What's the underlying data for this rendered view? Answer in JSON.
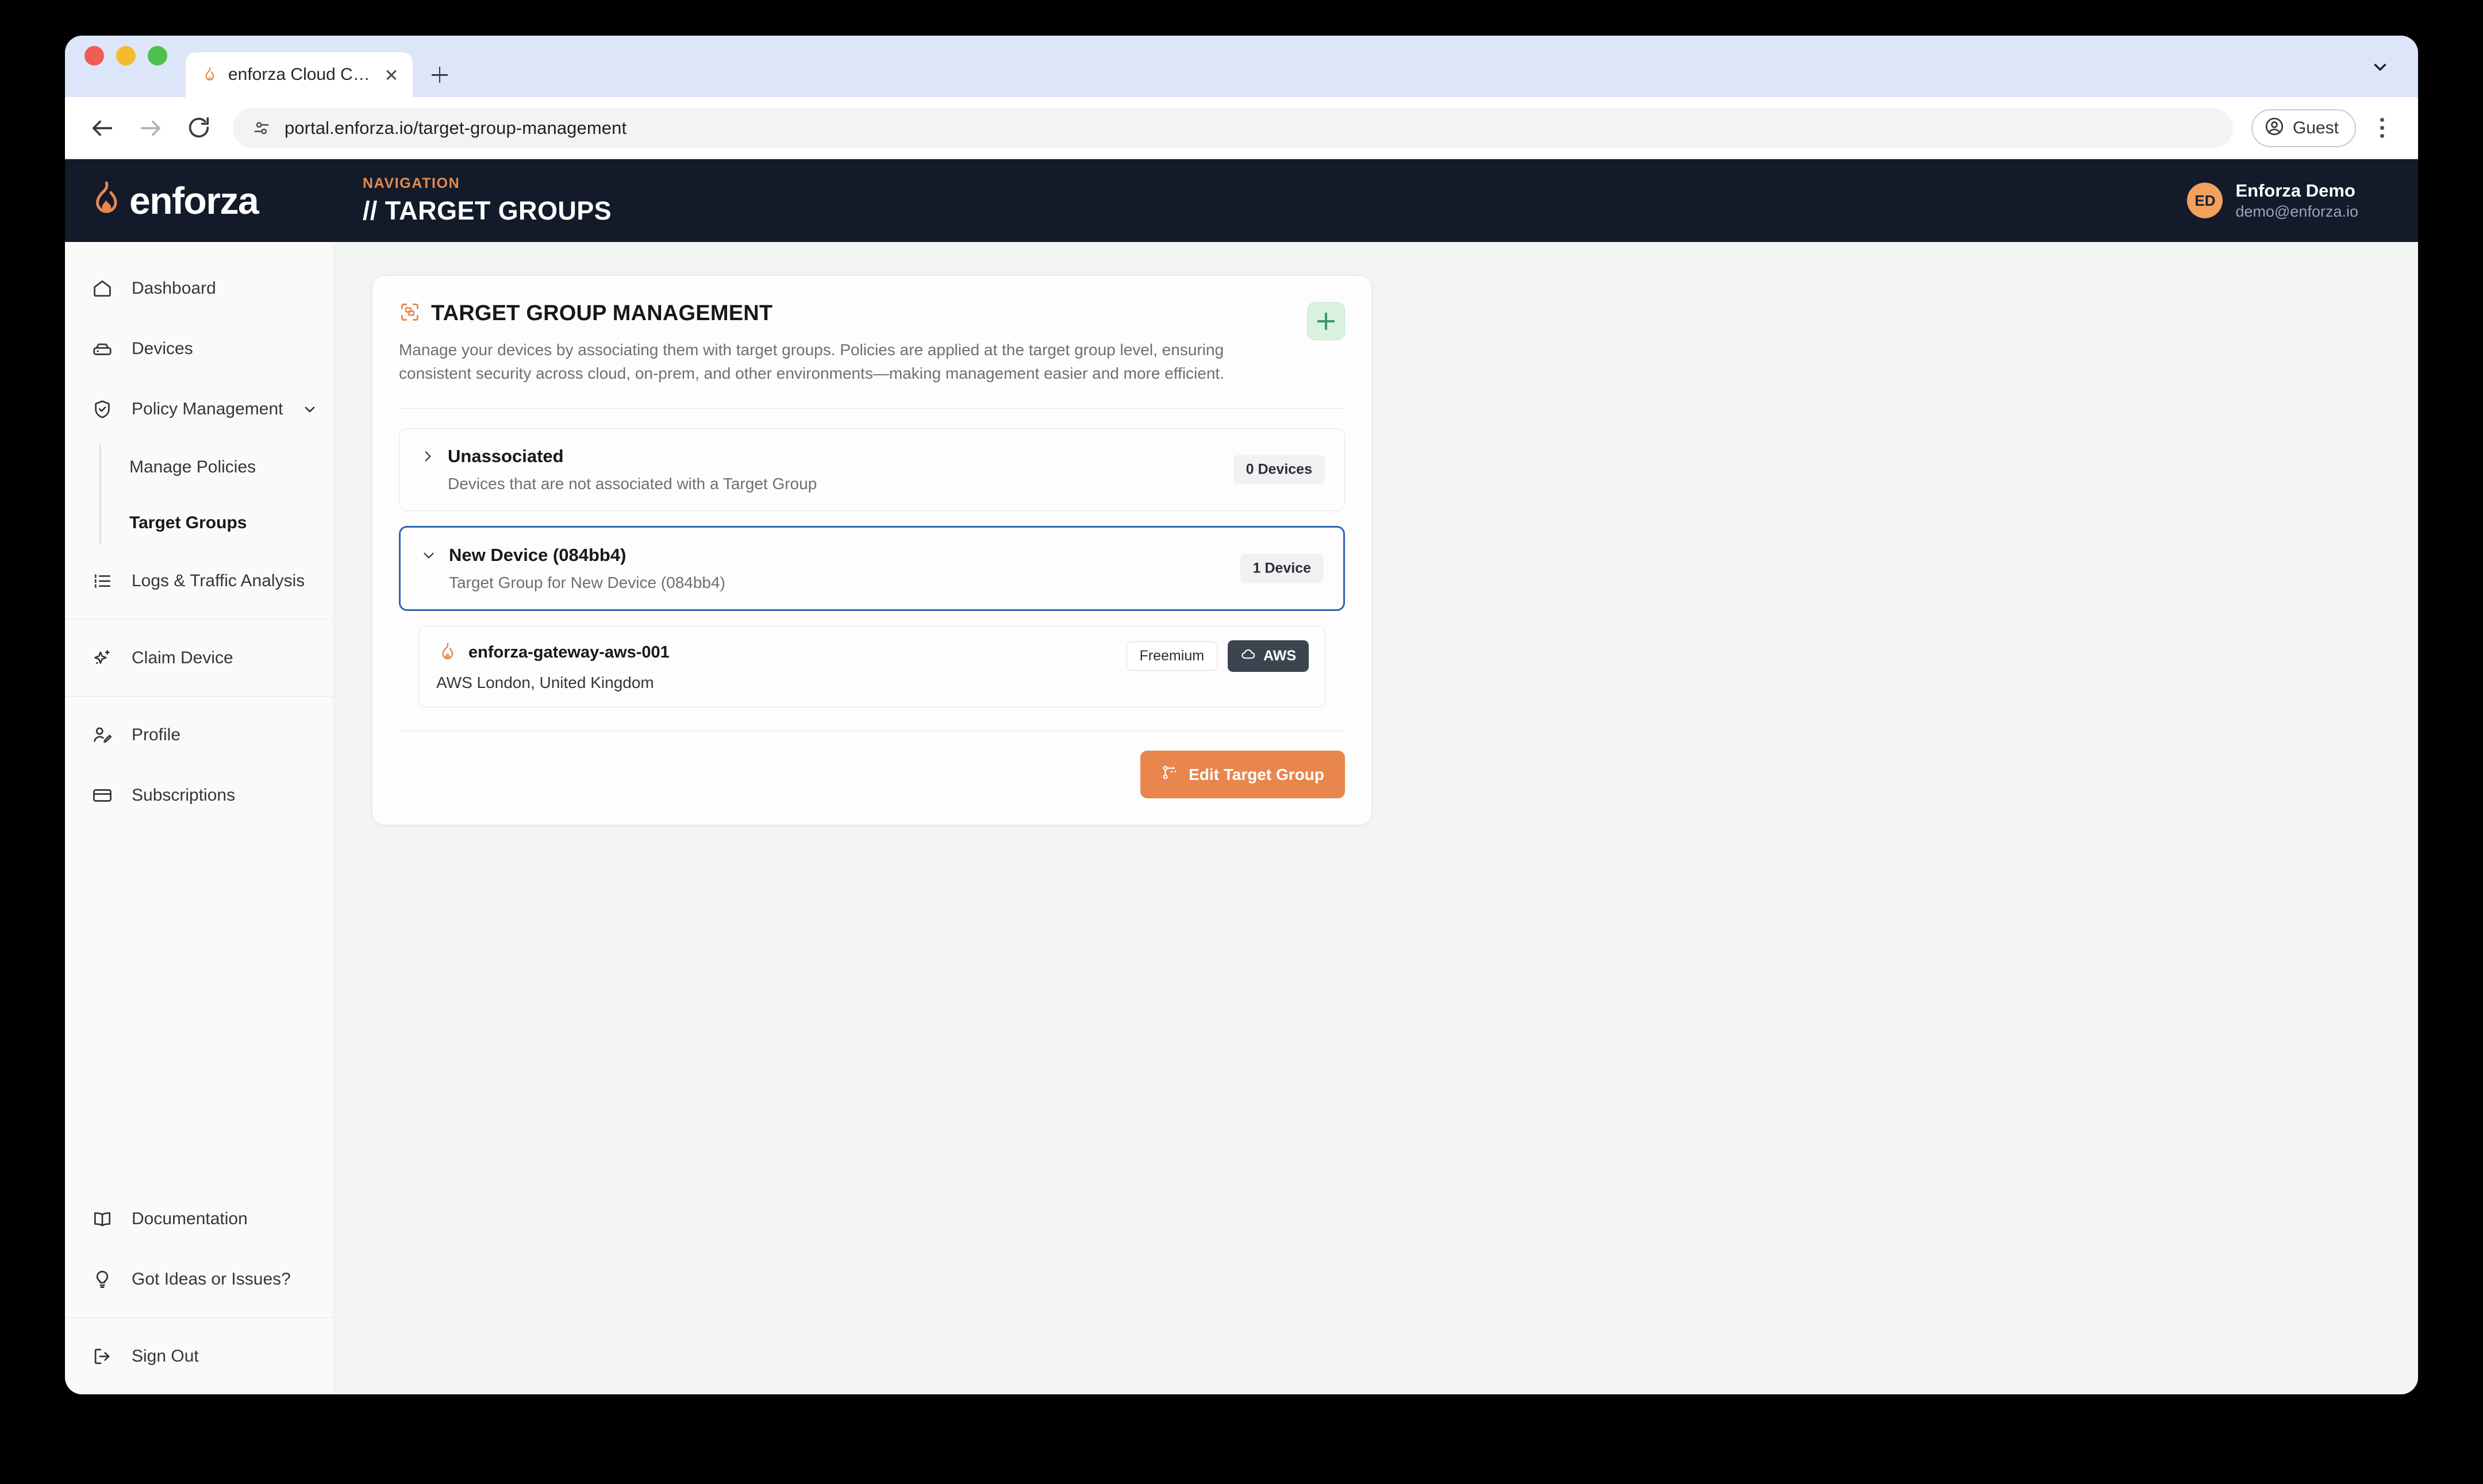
{
  "browser": {
    "tab": {
      "title": "enforza Cloud Controller",
      "favicon_icon": "flame-icon",
      "close_icon": "close-icon"
    },
    "new_tab_icon": "plus-icon",
    "tab_search_icon": "chevron-down-icon",
    "back_icon": "arrow-left-icon",
    "forward_icon": "arrow-right-icon",
    "reload_icon": "reload-icon",
    "site_info_icon": "tune-icon",
    "url": "portal.enforza.io/target-group-management",
    "profile": {
      "label": "Guest",
      "icon": "account-circle-icon"
    },
    "menu_icon": "kebab-menu-icon"
  },
  "header": {
    "logo_text": "enforza",
    "logo_icon": "flame-icon",
    "kicker": "NAVIGATION",
    "title": "// TARGET GROUPS",
    "user": {
      "initials": "ED",
      "name": "Enforza Demo",
      "email": "demo@enforza.io"
    }
  },
  "sidebar": {
    "items": [
      {
        "label": "Dashboard",
        "icon": "home-icon",
        "active": false
      },
      {
        "label": "Devices",
        "icon": "server-icon",
        "active": false
      },
      {
        "label": "Policy Management",
        "icon": "shield-check-icon",
        "expanded": true,
        "chevron": "chevron-down-icon"
      },
      {
        "label": "Logs & Traffic Analysis",
        "icon": "list-icon",
        "active": false
      },
      {
        "label": "Claim Device",
        "icon": "sparkle-icon",
        "active": false
      },
      {
        "label": "Profile",
        "icon": "user-edit-icon",
        "active": false
      },
      {
        "label": "Subscriptions",
        "icon": "credit-card-icon",
        "active": false
      }
    ],
    "submenu": [
      {
        "label": "Manage Policies",
        "active": false
      },
      {
        "label": "Target Groups",
        "active": true
      }
    ],
    "bottom": [
      {
        "label": "Documentation",
        "icon": "book-icon"
      },
      {
        "label": "Got Ideas or Issues?",
        "icon": "lightbulb-icon"
      },
      {
        "label": "Sign Out",
        "icon": "logout-icon"
      }
    ]
  },
  "card": {
    "icon": "scan-target-icon",
    "title": "TARGET GROUP MANAGEMENT",
    "description": "Manage your devices by associating them with target groups. Policies are applied at the target group level, ensuring consistent security across cloud, on-prem, and other environments—making management easier and more efficient.",
    "add_button_icon": "plus-icon",
    "groups": [
      {
        "name": "Unassociated",
        "subtitle": "Devices that are not associated with a Target Group",
        "badge": "0 Devices",
        "expanded": false,
        "chevron": "chevron-right-icon",
        "selected": false
      },
      {
        "name": "New Device (084bb4)",
        "subtitle": "Target Group for New Device (084bb4)",
        "badge": "1 Device",
        "expanded": true,
        "chevron": "chevron-down-icon",
        "selected": true
      }
    ],
    "device": {
      "icon": "flame-icon",
      "name": "enforza-gateway-aws-001",
      "location": "AWS London, United Kingdom",
      "tier_badge": "Freemium",
      "cloud_badge": "AWS",
      "cloud_icon": "cloud-icon"
    },
    "edit_button": {
      "label": "Edit Target Group",
      "icon": "network-nodes-icon"
    }
  },
  "colors": {
    "brand_orange": "#e8864e",
    "header_navy": "#131a2a",
    "selected_blue": "#2f63b5",
    "add_green": "#3d9960",
    "aws_dark": "#3c444f"
  }
}
